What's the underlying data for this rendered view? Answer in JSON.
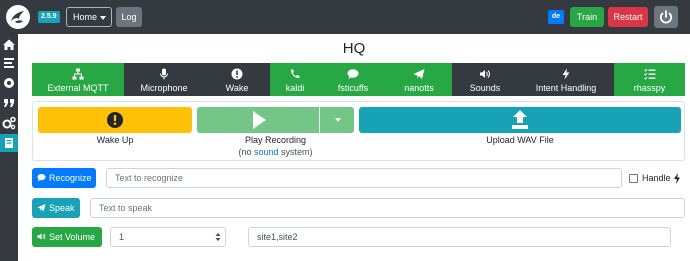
{
  "navbar": {
    "version": "2.5.9",
    "home_label": "Home",
    "log_label": "Log",
    "language": "de",
    "train_label": "Train",
    "restart_label": "Restart"
  },
  "sidebar": {
    "items": [
      {
        "icon": "home-icon"
      },
      {
        "icon": "list-icon"
      },
      {
        "icon": "record-icon"
      },
      {
        "icon": "quote-icon"
      },
      {
        "icon": "cogs-icon"
      },
      {
        "icon": "book-icon"
      }
    ]
  },
  "page_title": "HQ",
  "tabs": [
    {
      "label": "External MQTT",
      "icon": "network-icon",
      "color": "#28a745"
    },
    {
      "label": "Microphone",
      "icon": "microphone-icon",
      "color": "#343a40"
    },
    {
      "label": "Wake",
      "icon": "exclamation-icon",
      "color": "#343a40"
    },
    {
      "label": "kaldi",
      "icon": "phone-volume-icon",
      "color": "#28a745"
    },
    {
      "label": "fsticuffs",
      "icon": "comment-icon",
      "color": "#28a745"
    },
    {
      "label": "nanotts",
      "icon": "paper-plane-icon",
      "color": "#28a745"
    },
    {
      "label": "Sounds",
      "icon": "volume-icon",
      "color": "#343a40"
    },
    {
      "label": "Intent Handling",
      "icon": "bolt-icon",
      "color": "#343a40"
    },
    {
      "label": "rhasspy",
      "icon": "tasks-icon",
      "color": "#28a745"
    }
  ],
  "actions": {
    "wake_label": "Wake Up",
    "play_label": "Play Recording",
    "play_note_prefix": "(no",
    "play_note_link": "sound",
    "play_note_suffix": "system)",
    "upload_label": "Upload WAV File"
  },
  "recognize": {
    "button_label": "Recognize",
    "placeholder": "Text to recognize",
    "handle_label": "Handle"
  },
  "speak": {
    "button_label": "Speak",
    "placeholder": "Text to speak"
  },
  "volume": {
    "button_label": "Set Volume",
    "value": "1",
    "sites": "site1,site2"
  },
  "colors": {
    "primary": "#007bff",
    "success": "#28a745",
    "info": "#17a2b8",
    "warning": "#ffc107",
    "danger": "#dc3545",
    "dark": "#343a40"
  }
}
